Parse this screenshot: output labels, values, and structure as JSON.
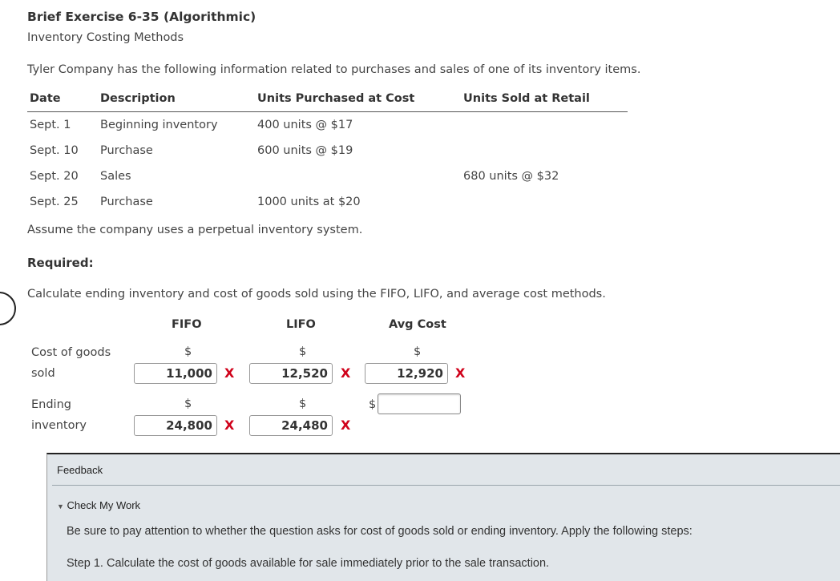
{
  "exercise": {
    "title": "Brief Exercise 6-35 (Algorithmic)",
    "subtitle": "Inventory Costing Methods",
    "intro": "Tyler Company has the following information related to purchases and sales of one of its inventory items."
  },
  "table": {
    "headers": [
      "Date",
      "Description",
      "Units Purchased at Cost",
      "Units Sold at Retail"
    ],
    "rows": [
      {
        "date": "Sept. 1",
        "description": "Beginning inventory",
        "purchased": "400 units @ $17",
        "sold": ""
      },
      {
        "date": "Sept. 10",
        "description": "Purchase",
        "purchased": "600 units @ $19",
        "sold": ""
      },
      {
        "date": "Sept. 20",
        "description": "Sales",
        "purchased": "",
        "sold": "680 units @ $32"
      },
      {
        "date": "Sept. 25",
        "description": "Purchase",
        "purchased": "1000 units at $20",
        "sold": ""
      }
    ]
  },
  "assumption": "Assume the company uses a perpetual inventory system.",
  "required_label": "Required:",
  "instruction": "Calculate ending inventory and cost of goods sold using the FIFO, LIFO, and average cost methods.",
  "answer_grid": {
    "columns": [
      "FIFO",
      "LIFO",
      "Avg Cost"
    ],
    "currency": "$",
    "incorrect_mark": "X",
    "rows": [
      {
        "label": "Cost of goods sold",
        "values": [
          "11,000",
          "12,520",
          "12,920"
        ],
        "marked": [
          true,
          true,
          true
        ]
      },
      {
        "label": "Ending inventory",
        "values": [
          "24,800",
          "24,480",
          ""
        ],
        "marked": [
          true,
          true,
          false
        ]
      }
    ]
  },
  "feedback": {
    "title": "Feedback",
    "toggle_label": "Check My Work",
    "lines": [
      "Be sure to pay attention to whether the question asks for cost of goods sold or ending inventory. Apply the following steps:",
      "Step 1. Calculate the cost of goods available for sale immediately prior to the sale transaction."
    ]
  },
  "colors": {
    "incorrect": "#d0021b",
    "feedback_bg": "#e1e6ea"
  }
}
